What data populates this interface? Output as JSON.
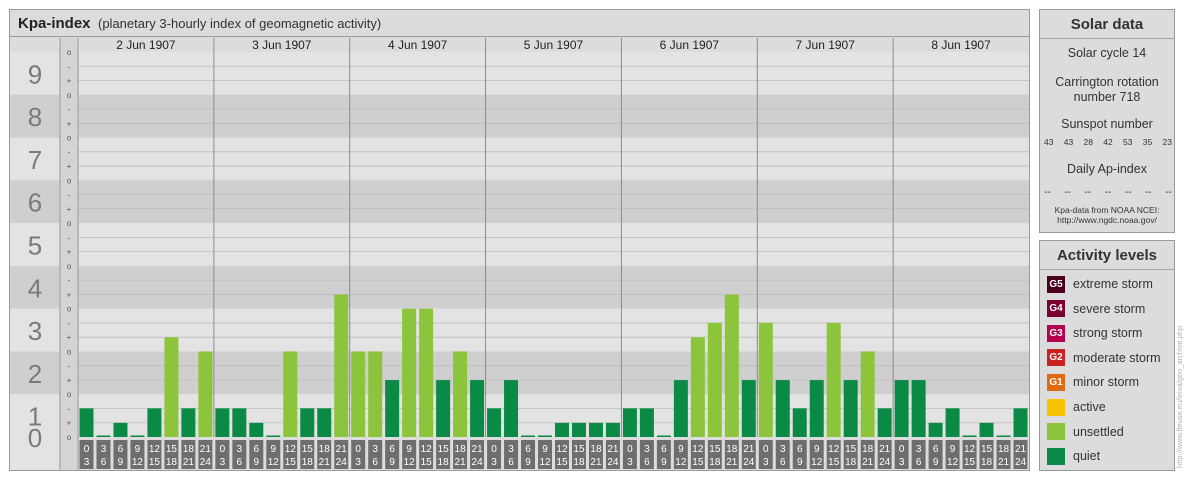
{
  "title": {
    "main": "Kpa-index",
    "sub": "(planetary 3-hourly index of geomagnetic activity)"
  },
  "chart_data": {
    "type": "bar",
    "y_axis_labels": [
      "0",
      "1",
      "2",
      "3",
      "4",
      "5",
      "6",
      "7",
      "8",
      "9"
    ],
    "sub_ticks": [
      "-",
      "o",
      "+"
    ],
    "ylim": [
      0,
      9
    ],
    "grid": true,
    "days": [
      "2 Jun 1907",
      "3 Jun 1907",
      "4 Jun 1907",
      "5 Jun 1907",
      "6 Jun 1907",
      "7 Jun 1907",
      "8 Jun 1907"
    ],
    "hour_bins": [
      [
        "0",
        "3"
      ],
      [
        "3",
        "6"
      ],
      [
        "6",
        "9"
      ],
      [
        "9",
        "12"
      ],
      [
        "12",
        "15"
      ],
      [
        "15",
        "18"
      ],
      [
        "18",
        "21"
      ],
      [
        "21",
        "24"
      ]
    ],
    "values": [
      0.67,
      0.0,
      0.33,
      0.0,
      0.67,
      2.33,
      0.67,
      2.0,
      0.67,
      0.67,
      0.33,
      0.0,
      2.0,
      0.67,
      0.67,
      3.33,
      2.0,
      2.0,
      1.33,
      3.0,
      3.0,
      1.33,
      2.0,
      1.33,
      0.67,
      1.33,
      0.0,
      0.0,
      0.33,
      0.33,
      0.33,
      0.33,
      0.67,
      0.67,
      0.0,
      1.33,
      2.33,
      2.67,
      3.33,
      1.33,
      2.67,
      1.33,
      0.67,
      1.33,
      2.67,
      1.33,
      2.0,
      0.67,
      1.33,
      1.33,
      0.33,
      0.67,
      0.0,
      0.33,
      0.0,
      0.67
    ],
    "levels": [
      {
        "code": "G5",
        "label": "extreme storm",
        "color": "#4a0020"
      },
      {
        "code": "G4",
        "label": "severe storm",
        "color": "#7a0033"
      },
      {
        "code": "G3",
        "label": "strong storm",
        "color": "#b3004f"
      },
      {
        "code": "G2",
        "label": "moderate storm",
        "color": "#cc2222"
      },
      {
        "code": "G1",
        "label": "minor storm",
        "color": "#e06a10"
      },
      {
        "code": "",
        "label": "active",
        "color": "#f7c300"
      },
      {
        "code": "",
        "label": "unsettled",
        "color": "#8cc43c"
      },
      {
        "code": "",
        "label": "quiet",
        "color": "#0a8a44"
      }
    ],
    "colors": {
      "quiet": "#0a8a44",
      "unsettled": "#8cc43c",
      "active": "#f7c300"
    }
  },
  "solar": {
    "title": "Solar data",
    "cycle": "Solar cycle 14",
    "carrington_line1": "Carrington rotation",
    "carrington_line2": "number 718",
    "sunspot_title": "Sunspot number",
    "sunspots": [
      "43",
      "43",
      "28",
      "42",
      "53",
      "35",
      "23"
    ],
    "ap_title": "Daily Ap-index",
    "ap_values": [
      "--",
      "--",
      "--",
      "--",
      "--",
      "--",
      "--"
    ],
    "source_line1": "Kpa-data from NOAA NCEI:",
    "source_line2": "http://www.ngdc.noaa.gov/"
  },
  "levels_title": "Activity levels",
  "credit": "http://www.fleuse.eu/leiva/geo_archive.php"
}
